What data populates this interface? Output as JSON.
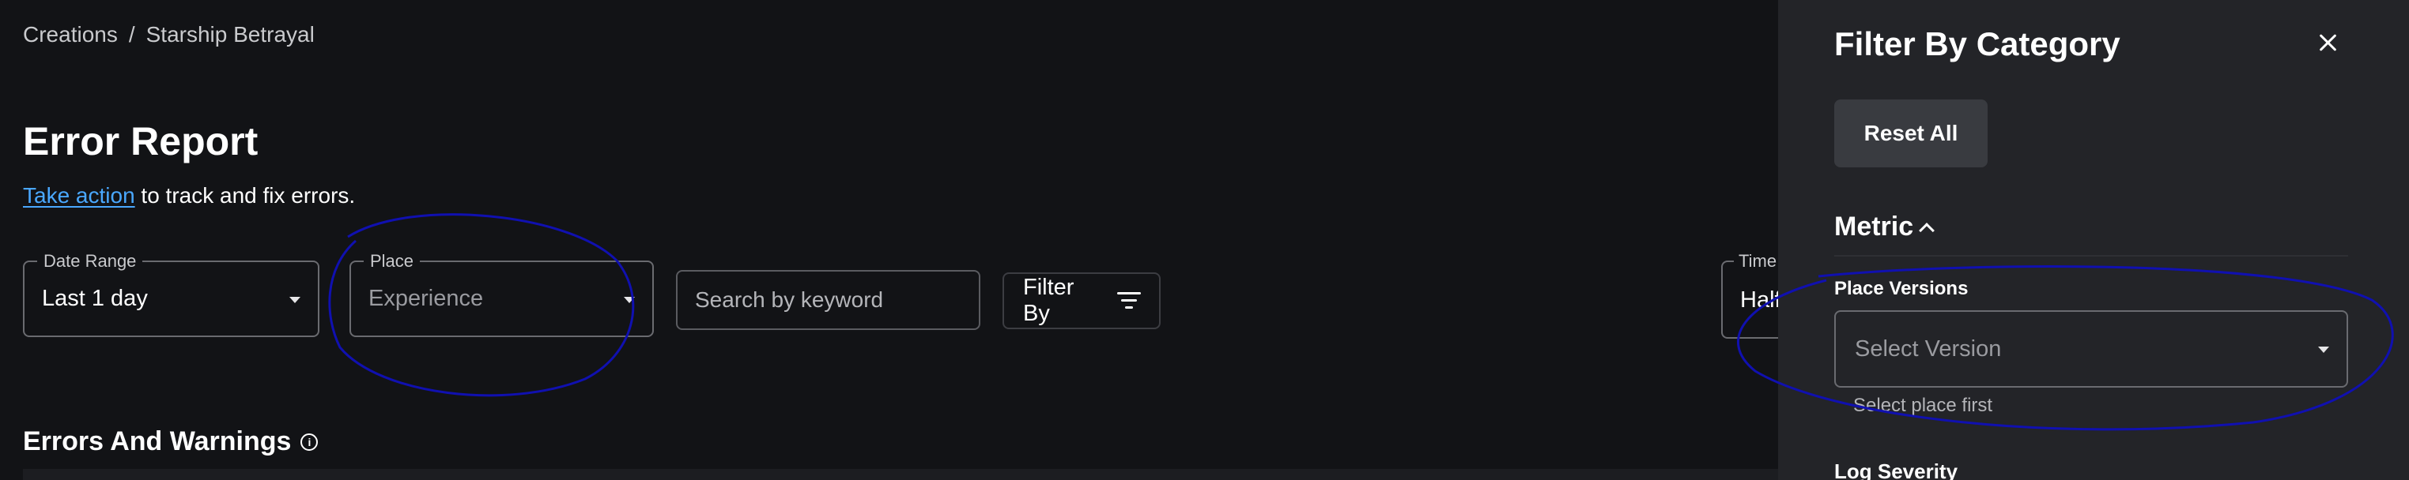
{
  "breadcrumb": {
    "parent": "Creations",
    "separator": "/",
    "current": "Starship Betrayal"
  },
  "header": {
    "title": "Error Report",
    "link_text": "Take action",
    "subtitle_rest": " to track and fix errors."
  },
  "filters": {
    "date_range": {
      "legend": "Date Range",
      "value": "Last 1 day"
    },
    "place": {
      "legend": "Place",
      "placeholder": "Experience"
    },
    "search": {
      "placeholder": "Search by keyword"
    },
    "filter_by": {
      "label": "Filter By"
    },
    "time": {
      "legend": "Time",
      "value": "Half"
    }
  },
  "section": {
    "title": "Errors And Warnings"
  },
  "panel": {
    "title": "Filter By Category",
    "reset_label": "Reset All",
    "metric_label": "Metric",
    "place_versions_label": "Place Versions",
    "place_versions_placeholder": "Select Version",
    "place_versions_helper": "Select place first",
    "log_severity_label": "Log Severity"
  },
  "colors": {
    "background": "#121316",
    "panel": "#232428",
    "link": "#4aa8ff",
    "annotation": "#1010b0"
  },
  "icons": [
    "chevron-down-icon",
    "filter-icon",
    "info-icon",
    "close-icon",
    "chevron-up-icon"
  ]
}
